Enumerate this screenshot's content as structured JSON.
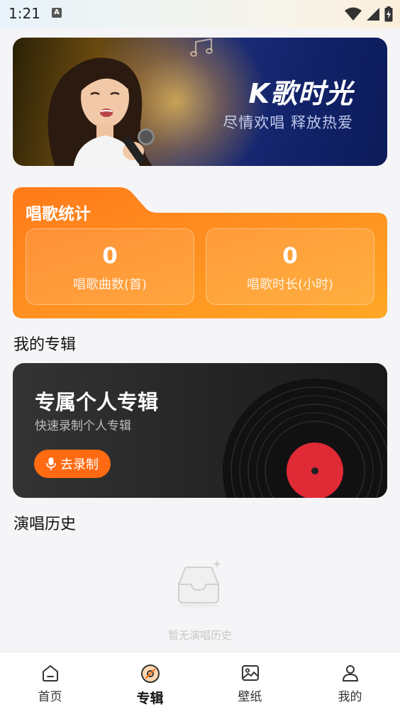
{
  "status_bar": {
    "time": "1:21",
    "notification_badge": "A",
    "icons": [
      "wifi-icon",
      "signal-icon",
      "battery-charging-icon"
    ]
  },
  "banner": {
    "title": "K歌时光",
    "subtitle": "尽情欢唱 释放热爱"
  },
  "stats": {
    "title": "唱歌统计",
    "items": [
      {
        "value": "0",
        "label": "唱歌曲数(首)"
      },
      {
        "value": "0",
        "label": "唱歌时长(小时)"
      }
    ]
  },
  "albums": {
    "section_title": "我的专辑",
    "card_title": "专属个人专辑",
    "card_subtitle": "快速录制个人专辑",
    "record_button": "去录制"
  },
  "history": {
    "section_title": "演唱历史",
    "empty_text": "暂无演唱历史"
  },
  "tabbar": {
    "tabs": [
      {
        "label": "首页",
        "icon": "home-icon",
        "active": false
      },
      {
        "label": "专辑",
        "icon": "disc-icon",
        "active": true
      },
      {
        "label": "壁纸",
        "icon": "image-icon",
        "active": false
      },
      {
        "label": "我的",
        "icon": "user-icon",
        "active": false
      }
    ]
  },
  "colors": {
    "accent": "#ff6a12",
    "stats_gradient_start": "#ff7a1a",
    "stats_gradient_end": "#ffa726",
    "background": "#f5f5f7"
  }
}
